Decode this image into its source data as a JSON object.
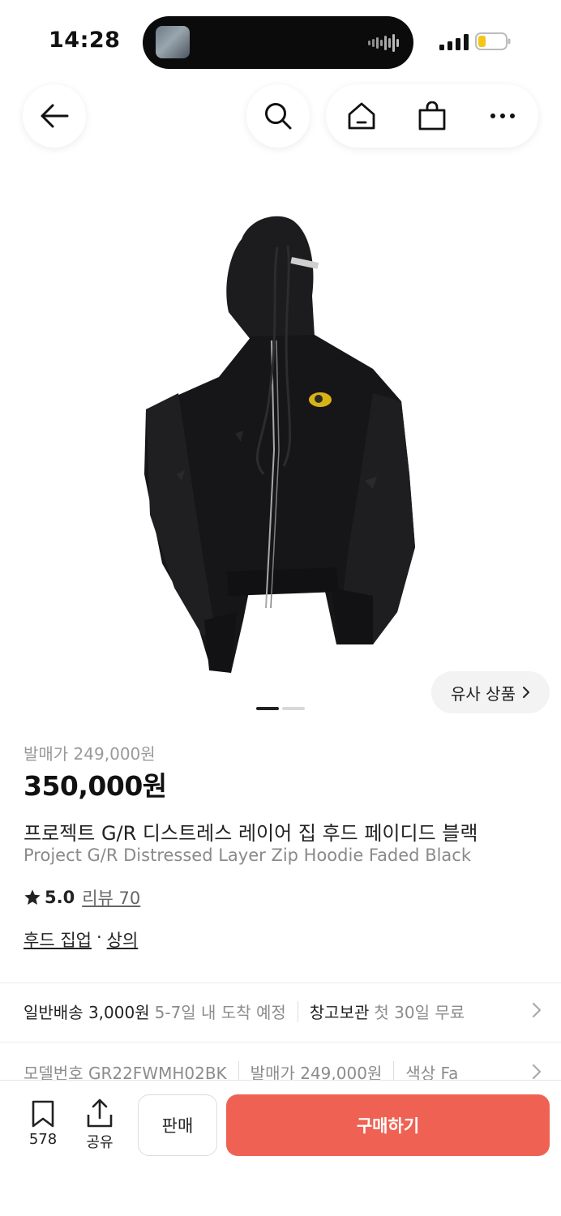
{
  "status_bar": {
    "time": "14:28"
  },
  "nav": {
    "back_icon": "arrow-left-icon",
    "search_icon": "search-icon",
    "home_icon": "home-icon",
    "bag_icon": "shopping-bag-icon",
    "more_icon": "more-horizontal-icon"
  },
  "gallery": {
    "similar_label": "유사 상품",
    "similar_icon": "chevron-right-icon",
    "image_alt": "black hoodie photo"
  },
  "product": {
    "release_price": "발매가 249,000원",
    "price": "350,000원",
    "name_ko": "프로젝트 G/R 디스트레스 레이어 집 후드 페이디드 블랙",
    "name_en": "Project G/R Distressed Layer Zip Hoodie Faded Black",
    "rating": "5.0",
    "reviews": "리뷰 70",
    "category_1": "후드 집업",
    "category_sep": "·",
    "category_2": "상의"
  },
  "shipping": {
    "standard_label": "일반배송 3,000원",
    "standard_eta": "5-7일 내 도착 예정",
    "storage_label": "창고보관",
    "storage_note": "첫 30일 무료"
  },
  "specs": {
    "model": "모델번호 GR22FWMH02BK",
    "release": "발매가 249,000원",
    "color": "색상 Fa"
  },
  "bottom_bar": {
    "bookmark_count": "578",
    "share_label": "공유",
    "sell_label": "판매",
    "buy_label": "구매하기"
  },
  "colors": {
    "accent": "#ef6253",
    "text": "#222222",
    "muted": "#8c8c8c"
  }
}
